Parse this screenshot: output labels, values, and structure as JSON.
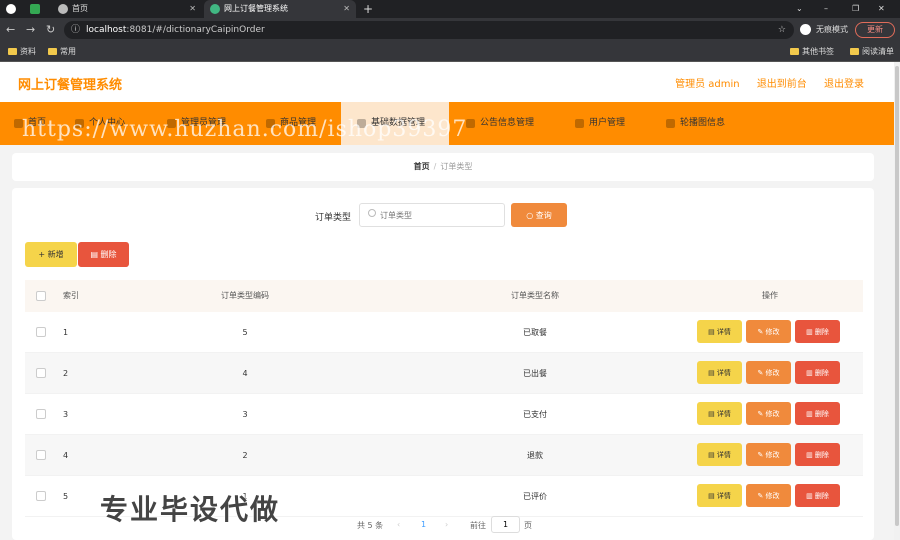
{
  "browser": {
    "tabs": [
      {
        "label": "首页"
      },
      {
        "label": "网上订餐管理系统"
      }
    ],
    "url_host": "localhost",
    "url_rest": ":8081/#/dictionaryCaipinOrder",
    "incognito_label": "无痕模式",
    "update_label": "更新",
    "bookmarks": [
      "资料",
      "常用"
    ],
    "bookmarks_right": [
      "其他书签",
      "阅读清单"
    ]
  },
  "app": {
    "title": "网上订餐管理系统",
    "admin_label": "管理员 admin",
    "to_front_label": "退出到前台",
    "logout_label": "退出登录"
  },
  "menu": [
    {
      "label": "首页"
    },
    {
      "label": "个人中心"
    },
    {
      "label": "管理员管理"
    },
    {
      "label": "商品管理"
    },
    {
      "label": "基础数据管理"
    },
    {
      "label": "公告信息管理"
    },
    {
      "label": "用户管理"
    },
    {
      "label": "轮播图信息"
    }
  ],
  "watermark": "https://www.huzhan.com/ishop39397",
  "breadcrumb": {
    "home": "首页",
    "sep": "/",
    "current": "订单类型"
  },
  "search": {
    "label": "订单类型",
    "placeholder": "订单类型",
    "button": "查询"
  },
  "actions": {
    "add": "+ 新增",
    "delete": "删除"
  },
  "table": {
    "headers": {
      "index": "索引",
      "code": "订单类型编码",
      "name": "订单类型名称",
      "ops": "操作"
    },
    "op_labels": {
      "detail": "详情",
      "edit": "修改",
      "remove": "删除"
    },
    "rows": [
      {
        "index": "1",
        "code": "5",
        "name": "已取餐"
      },
      {
        "index": "2",
        "code": "4",
        "name": "已出餐"
      },
      {
        "index": "3",
        "code": "3",
        "name": "已支付"
      },
      {
        "index": "4",
        "code": "2",
        "name": "退款"
      },
      {
        "index": "5",
        "code": "1",
        "name": "已评价"
      }
    ]
  },
  "pager": {
    "total": "共 5 条",
    "prev": "‹",
    "page": "1",
    "next": "›",
    "goto": "前往",
    "goto_value": "1",
    "unit": "页"
  },
  "overlay": "专业毕设代做",
  "colors": {
    "accent": "#ff8c00",
    "detail": "#f5d44a",
    "edit": "#f08a3c",
    "remove": "#e8553d"
  }
}
